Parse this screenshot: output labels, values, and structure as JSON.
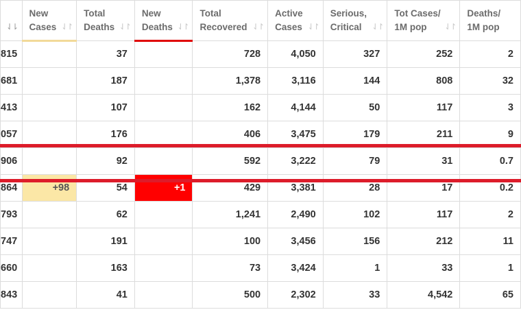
{
  "columns": [
    {
      "key": "total_cases",
      "label": ""
    },
    {
      "key": "new_cases",
      "label": "New\nCases"
    },
    {
      "key": "total_deaths",
      "label": "Total\nDeaths"
    },
    {
      "key": "new_deaths",
      "label": "New\nDeaths"
    },
    {
      "key": "total_recovered",
      "label": "Total\nRecovered"
    },
    {
      "key": "active_cases",
      "label": "Active\nCases"
    },
    {
      "key": "serious_critical",
      "label": "Serious,\nCritical"
    },
    {
      "key": "tot_cases_1m",
      "label": "Tot Cases/\n1M pop"
    },
    {
      "key": "deaths_1m",
      "label": "Deaths/\n1M pop"
    }
  ],
  "sort_icon": "sort-arrows-icon",
  "rows": [
    [
      "815",
      "",
      "37",
      "",
      "728",
      "4,050",
      "327",
      "252",
      "2"
    ],
    [
      "681",
      "",
      "187",
      "",
      "1,378",
      "3,116",
      "144",
      "808",
      "32"
    ],
    [
      "413",
      "",
      "107",
      "",
      "162",
      "4,144",
      "50",
      "117",
      "3"
    ],
    [
      "057",
      "",
      "176",
      "",
      "406",
      "3,475",
      "179",
      "211",
      "9"
    ],
    [
      "906",
      "",
      "92",
      "",
      "592",
      "3,222",
      "79",
      "31",
      "0.7"
    ],
    [
      "864",
      "+98",
      "54",
      "+1",
      "429",
      "3,381",
      "28",
      "17",
      "0.2"
    ],
    [
      "793",
      "",
      "62",
      "",
      "1,241",
      "2,490",
      "102",
      "117",
      "2"
    ],
    [
      "747",
      "",
      "191",
      "",
      "100",
      "3,456",
      "156",
      "212",
      "11"
    ],
    [
      "660",
      "",
      "163",
      "",
      "73",
      "3,424",
      "1",
      "33",
      "1"
    ],
    [
      "843",
      "",
      "41",
      "",
      "500",
      "2,302",
      "33",
      "4,542",
      "65"
    ]
  ],
  "colors": {
    "new_cases_highlight": "#fbe7a6",
    "new_deaths_highlight": "#ff0000",
    "annotation_lines": "#dd1c2a"
  }
}
